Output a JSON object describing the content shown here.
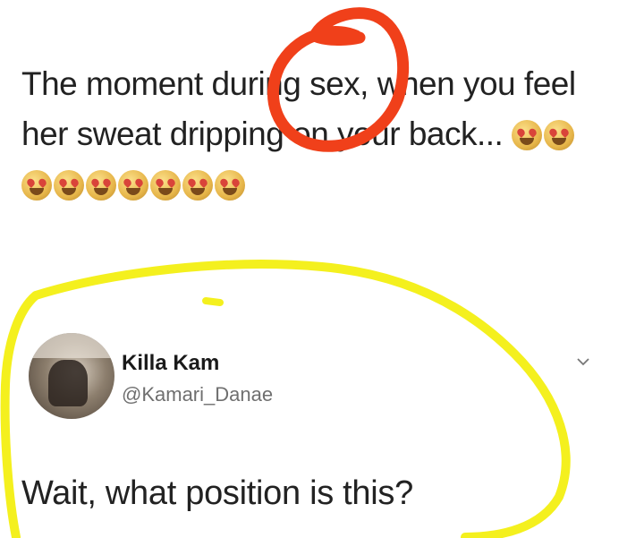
{
  "tweet": {
    "text_line1": "The moment during sex, when you feel",
    "text_line2": "her sweat dripping on your back...",
    "emoji_name": "smiling-face-with-heart-eyes"
  },
  "reply": {
    "display_name": "Killa Kam",
    "handle": "@Kamari_Danae",
    "text": "Wait, what position is this?"
  },
  "colors": {
    "text": "#222222",
    "handle": "#6f6f6f",
    "red_annotation": "#f0401a",
    "yellow_annotation": "#f4f01e"
  }
}
